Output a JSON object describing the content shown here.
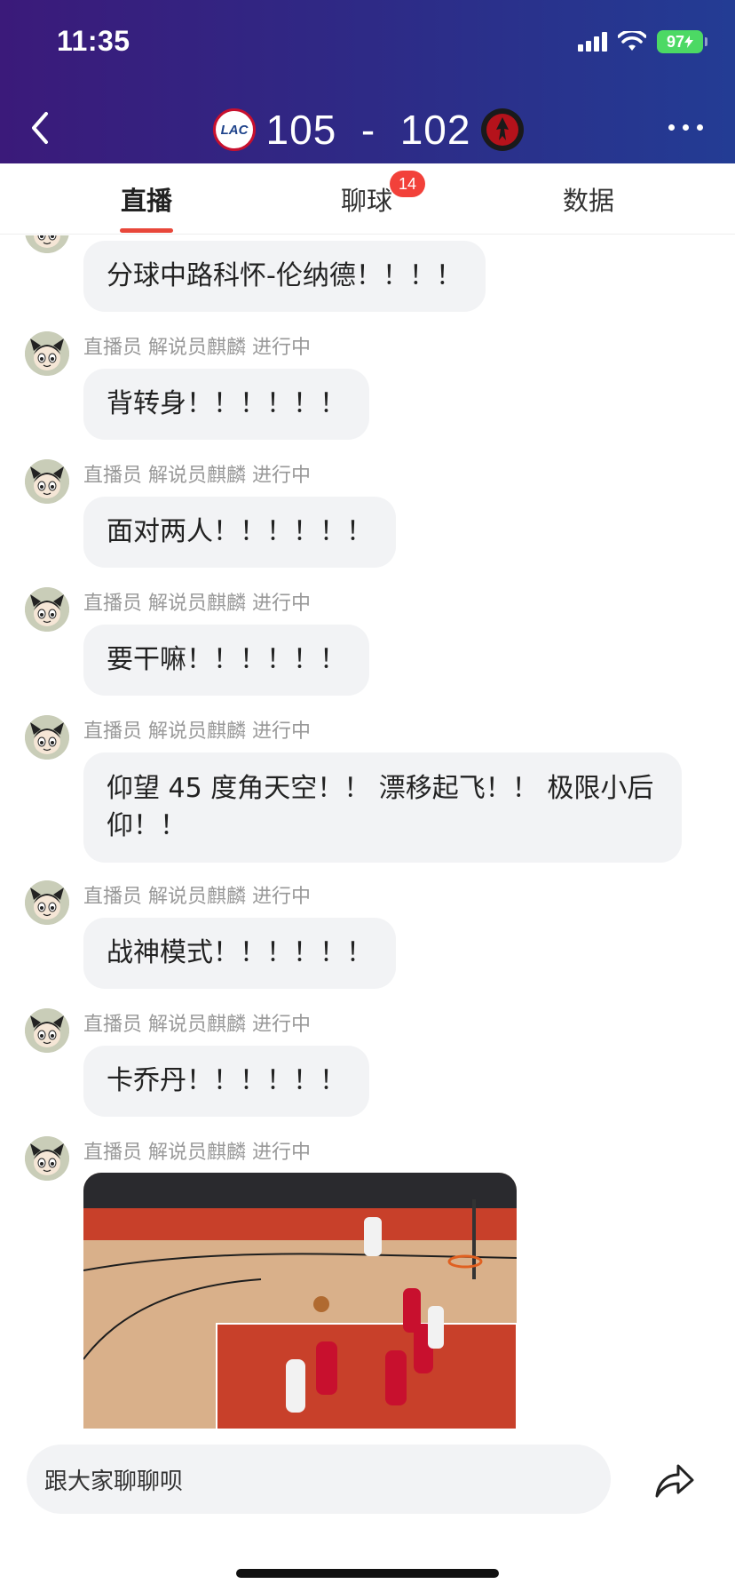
{
  "status_bar": {
    "time": "11:35",
    "battery": "97"
  },
  "scoreboard": {
    "home_logo_text": "LAC",
    "score": "105  -  102"
  },
  "tabs": [
    {
      "label": "直播",
      "active": true
    },
    {
      "label": "聊球",
      "badge": "14"
    },
    {
      "label": "数据"
    }
  ],
  "feed": {
    "messages": [
      {
        "meta": "",
        "text": "分球中路科怀-伦纳德！！！！"
      },
      {
        "meta": "直播员 解说员麒麟 进行中",
        "text": "背转身！！！！！！"
      },
      {
        "meta": "直播员 解说员麒麟 进行中",
        "text": "面对两人！！！！！！"
      },
      {
        "meta": "直播员 解说员麒麟 进行中",
        "text": "要干嘛！！！！！！"
      },
      {
        "meta": "直播员 解说员麒麟 进行中",
        "text_line1": "仰望 45 度角天空！！ 漂移起飞！！ 极限小后",
        "text_line2": "仰！！"
      },
      {
        "meta": "直播员 解说员麒麟 进行中",
        "text": "战神模式！！！！！！"
      },
      {
        "meta": "直播员 解说员麒麟 进行中",
        "text": "卡乔丹！！！！！！"
      },
      {
        "meta": "直播员 解说员麒麟 进行中"
      }
    ]
  },
  "chat": {
    "placeholder": "跟大家聊聊呗"
  },
  "colors": {
    "accent": "#e8473a",
    "badge": "#f2413a",
    "header_start": "#3b1a7a",
    "header_end": "#233c94",
    "bubble": "#f2f3f5"
  }
}
